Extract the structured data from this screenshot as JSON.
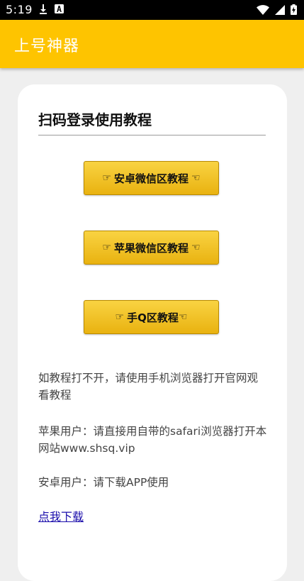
{
  "status_bar": {
    "time": "5:19",
    "icons_left": [
      "download-icon",
      "font-a-icon"
    ],
    "icons_right": [
      "wifi-icon",
      "signal-icon",
      "battery-charging-icon"
    ]
  },
  "app_bar": {
    "title": "上号神器",
    "color": "#fec400"
  },
  "card": {
    "title": "扫码登录使用教程",
    "buttons": [
      {
        "hand_left": "☞",
        "label": "安卓微信区教程",
        "hand_right": "☜"
      },
      {
        "hand_left": "☞",
        "label": "苹果微信区教程",
        "hand_right": "☜"
      },
      {
        "hand_left": "☞",
        "label": "手Q区教程",
        "hand_right": "☜"
      }
    ],
    "info": [
      "如教程打不开，请使用手机浏览器打开官网观看教程",
      "苹果用户：请直接用自带的safari浏览器打开本网站www.shsq.vip",
      "安卓用户：请下载APP使用"
    ],
    "download_link": "点我下载"
  }
}
